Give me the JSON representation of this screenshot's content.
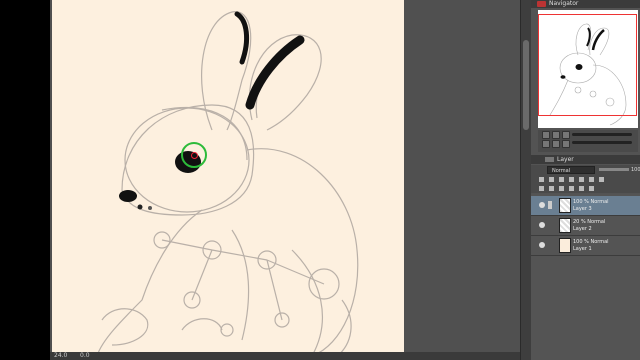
{
  "canvas": {
    "paper_color": "#fdf0df",
    "sketch_color": "#b9b0a8",
    "ink_color": "#111111"
  },
  "statusbar": {
    "zoom": "24.0",
    "coords": "0.0"
  },
  "navigator": {
    "title": "Navigator",
    "accent": "#e33333"
  },
  "layer_panel": {
    "title": "Layer",
    "blend_mode": "Normal",
    "opacity": "100",
    "layers": [
      {
        "mode": "100 % Normal",
        "name": "Layer 3",
        "selected": true,
        "type": "transparent"
      },
      {
        "mode": "20 % Normal",
        "name": "Layer 2",
        "selected": false,
        "type": "transparent"
      },
      {
        "mode": "100 % Normal",
        "name": "Layer 1",
        "selected": false,
        "type": "paper"
      }
    ]
  },
  "colors": {
    "selection": "#6a7f92",
    "brush_ring": "#2dbb3a",
    "brush_center": "#e22233"
  }
}
